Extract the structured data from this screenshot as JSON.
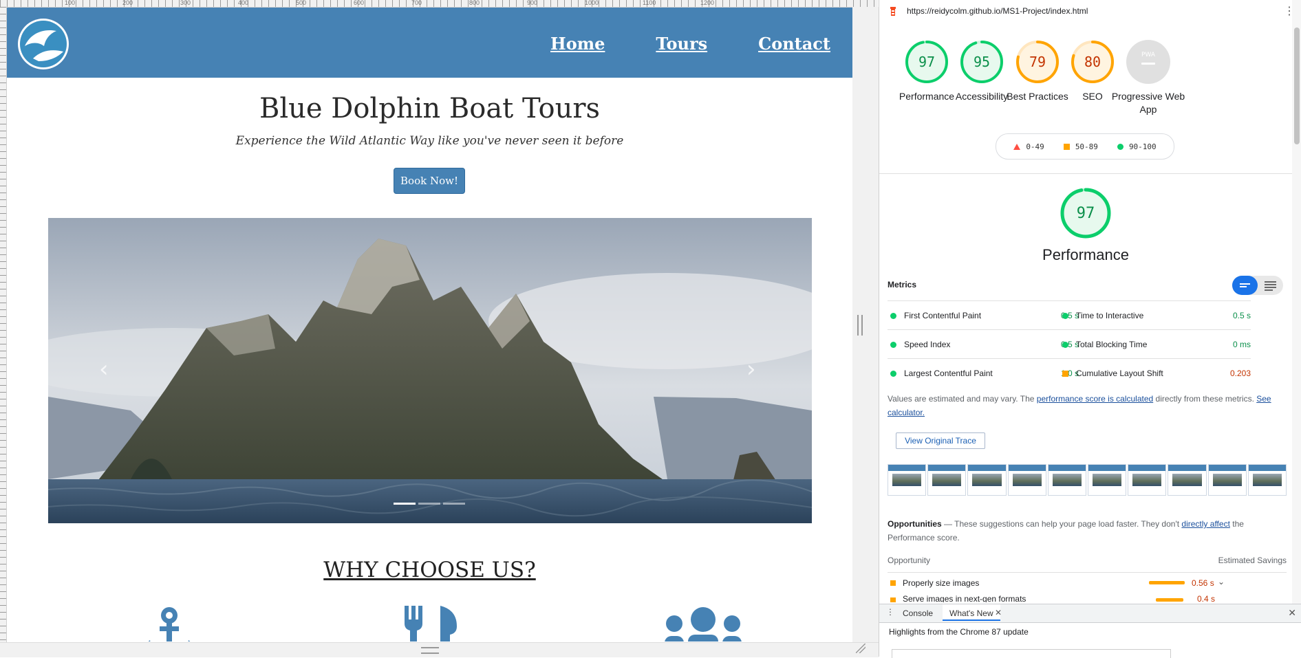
{
  "rulers": [
    "100",
    "200",
    "300",
    "400",
    "500",
    "600",
    "700",
    "800",
    "900",
    "1000",
    "1100",
    "1200"
  ],
  "site": {
    "nav": {
      "links": [
        "Home",
        "Tours",
        "Contact"
      ]
    },
    "hero_title": "Blue Dolphin Boat Tours",
    "hero_subtitle": "Experience the Wild Atlantic Way like you've never seen it before",
    "book_button": "Book Now!",
    "carousel": {
      "prev": "‹",
      "next": "›",
      "slides": 3,
      "active_slide": 1
    },
    "section_title": "WHY CHOOSE US?",
    "feature_icons": [
      "anchor-icon",
      "utensils-icon",
      "users-icon"
    ],
    "brand_color": "#4682b4"
  },
  "devtools": {
    "url": "https://reidycolm.github.io/MS1-Project/index.html",
    "gauges": [
      {
        "score": "97",
        "label": "Performance",
        "status": "pass",
        "fraction": 0.97
      },
      {
        "score": "95",
        "label": "Accessibility",
        "status": "pass",
        "fraction": 0.95
      },
      {
        "score": "79",
        "label": "Best Practices",
        "status": "average",
        "fraction": 0.79
      },
      {
        "score": "80",
        "label": "SEO",
        "status": "average",
        "fraction": 0.8
      },
      {
        "score": "",
        "badge": "PWA",
        "label": "Progressive Web App",
        "status": "na"
      }
    ],
    "legend": [
      "0-49",
      "50-89",
      "90-100"
    ],
    "performance": {
      "score": "97",
      "title": "Performance",
      "fraction": 0.97
    },
    "metrics_label": "Metrics",
    "metrics": [
      {
        "name": "First Contentful Paint",
        "value": "0.5 s",
        "status": "pass"
      },
      {
        "name": "Time to Interactive",
        "value": "0.5 s",
        "status": "pass"
      },
      {
        "name": "Speed Index",
        "value": "0.5 s",
        "status": "pass"
      },
      {
        "name": "Total Blocking Time",
        "value": "0 ms",
        "status": "pass"
      },
      {
        "name": "Largest Contentful Paint",
        "value": "1.0 s",
        "status": "pass"
      },
      {
        "name": "Cumulative Layout Shift",
        "value": "0.203",
        "status": "fail"
      }
    ],
    "note": {
      "before": "Values are estimated and may vary. The ",
      "link1": "performance score is calculated",
      "middle": " directly from these metrics. ",
      "link2": "See calculator."
    },
    "view_trace": "View Original Trace",
    "opportunities": {
      "title": "Opportunities",
      "text_before": " — These suggestions can help your page load faster. They don't ",
      "link": "directly affect",
      "text_after": " the Performance score.",
      "col_opportunity": "Opportunity",
      "col_savings": "Estimated Savings",
      "rows": [
        {
          "name": "Properly size images",
          "savings": "0.56 s"
        },
        {
          "name": "Serve images in next-gen formats",
          "savings": "0.4 s"
        }
      ]
    },
    "drawer": {
      "tabs": [
        "Console",
        "What's New"
      ],
      "highlights": "Highlights from the Chrome 87 update"
    },
    "colors": {
      "pass": "#0cce6b",
      "average": "#ffa400",
      "fail": "#ff4e42",
      "link": "#1a4f9c"
    }
  }
}
